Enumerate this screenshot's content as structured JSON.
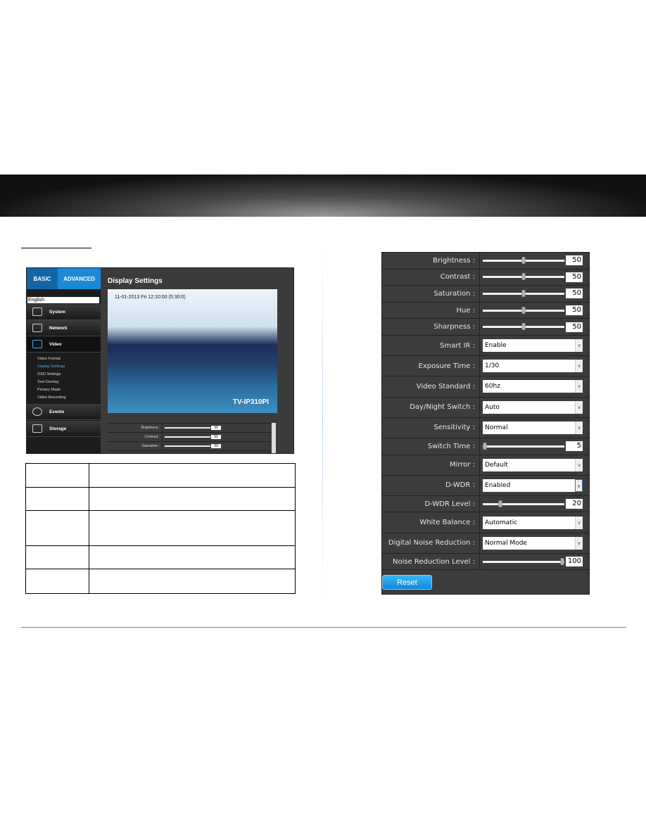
{
  "colors": {
    "accent": "#1c88d6",
    "panel": "#3c3c3c"
  },
  "left_screenshot": {
    "tabs": [
      "BASIC",
      "ADVANCED"
    ],
    "language": "English",
    "sections": [
      "System",
      "Network",
      "Video",
      "Events",
      "Storage"
    ],
    "video_items": [
      "Video Format",
      "Display Settings",
      "OSD Settings",
      "Text Overlay",
      "Privacy Mask",
      "Video Recording"
    ],
    "active_item": "Display Settings",
    "title": "Display Settings",
    "timestamp": "11-01-2013 Fri 12:10:00 (5:30:0)",
    "camera_name": "TV-IP310PI",
    "mini_rows": [
      {
        "label": "Brightness :",
        "value": "50"
      },
      {
        "label": "Contrast :",
        "value": "50"
      },
      {
        "label": "Saturation :",
        "value": "50"
      }
    ]
  },
  "settings": {
    "rows": [
      {
        "label": "Brightness :",
        "type": "slider",
        "value": "50",
        "level": 50
      },
      {
        "label": "Contrast :",
        "type": "slider",
        "value": "50",
        "level": 50
      },
      {
        "label": "Saturation :",
        "type": "slider",
        "value": "50",
        "level": 50
      },
      {
        "label": "Hue :",
        "type": "slider",
        "value": "50",
        "level": 50
      },
      {
        "label": "Sharpness :",
        "type": "slider",
        "value": "50",
        "level": 50
      },
      {
        "label": "Smart IR :",
        "type": "select",
        "value": "Enable"
      },
      {
        "label": "Exposure Time :",
        "type": "select",
        "value": "1/30"
      },
      {
        "label": "Video Standard :",
        "type": "select",
        "value": "60hz"
      },
      {
        "label": "Day/Night Switch :",
        "type": "select",
        "value": "Auto"
      },
      {
        "label": "Sensitivity :",
        "type": "select",
        "value": "Normal"
      },
      {
        "label": "Switch Time :",
        "type": "slider",
        "value": "5",
        "level": 0
      },
      {
        "label": "Mirror :",
        "type": "select",
        "value": "Default"
      },
      {
        "label": "D-WDR :",
        "type": "select",
        "value": "Enabled",
        "focused": true
      },
      {
        "label": "D-WDR Level :",
        "type": "slider",
        "value": "20",
        "level": 20
      },
      {
        "label": "White Balance :",
        "type": "select",
        "value": "Automatic"
      },
      {
        "label": "Digital Noise Reduction :",
        "type": "select",
        "value": "Normal Mode"
      },
      {
        "label": "Noise Reduction Level :",
        "type": "slider",
        "value": "100",
        "level": 100
      }
    ],
    "reset_label": "Reset"
  }
}
